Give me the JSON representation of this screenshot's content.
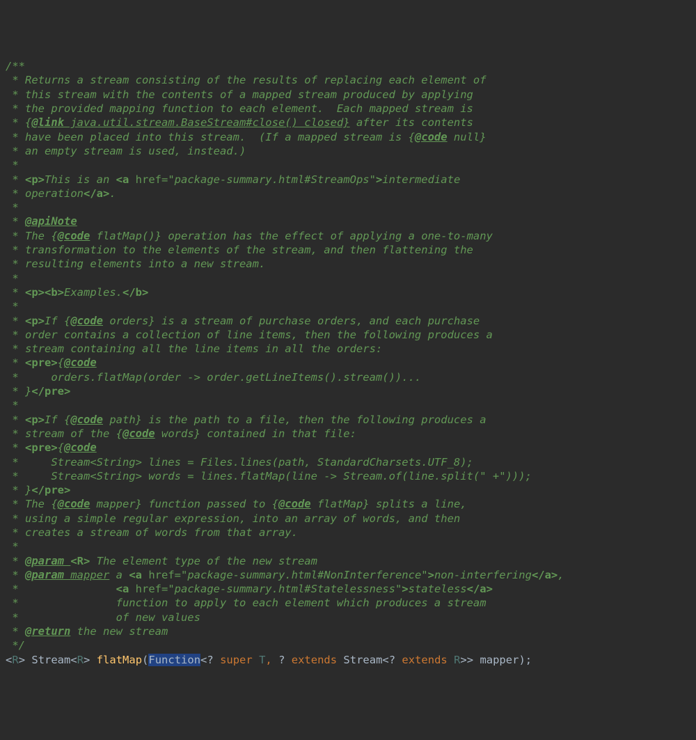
{
  "doc": {
    "l1": "/**",
    "l2a": " * ",
    "l2b": "Returns a stream consisting of the results of replacing each element of",
    "l3a": " * ",
    "l3b": "this stream with the contents of a mapped stream produced by applying",
    "l4a": " * ",
    "l4b": "the provided mapping function to each element.  Each mapped stream is",
    "l5a": " * ",
    "l5b": "{",
    "l5c": "@link",
    "l5d": " java.util.stream.BaseStream#close() closed}",
    "l5e": " after its contents",
    "l6a": " * ",
    "l6b": "have been placed into this stream.  (If a mapped stream is {",
    "l6c": "@code",
    "l6d": " null}",
    "l7a": " * ",
    "l7b": "an empty stream is used, instead.)",
    "l8": " *",
    "l9a": " * ",
    "l9b": "<p>",
    "l9c": "This is an ",
    "l9d": "<a ",
    "l9e": "href=",
    "l9f": "\"package-summary.html#StreamOps\"",
    "l9g": ">",
    "l9h": "intermediate",
    "l10a": " * ",
    "l10b": "operation",
    "l10c": "</a>",
    "l10d": ".",
    "l11": " *",
    "l12a": " * ",
    "l12b": "@apiNote",
    "l13a": " * ",
    "l13b": "The {",
    "l13c": "@code",
    "l13d": " flatMap()} operation has the effect of applying a one-to-many",
    "l14a": " * ",
    "l14b": "transformation to the elements of the stream, and then flattening the",
    "l15a": " * ",
    "l15b": "resulting elements into a new stream.",
    "l16": " *",
    "l17a": " * ",
    "l17b": "<p><b>",
    "l17c": "Examples.",
    "l17d": "</b>",
    "l18": " *",
    "l19a": " * ",
    "l19b": "<p>",
    "l19c": "If {",
    "l19d": "@code",
    "l19e": " orders} is a stream of purchase orders, and each purchase",
    "l20a": " * ",
    "l20b": "order contains a collection of line items, then the following produces a",
    "l21a": " * ",
    "l21b": "stream containing all the line items in all the orders:",
    "l22a": " * ",
    "l22b": "<pre>",
    "l22c": "{",
    "l22d": "@code",
    "l23a": " * ",
    "l23b": "    orders.flatMap(order -> order.getLineItems().stream())...",
    "l24a": " * ",
    "l24b": "}",
    "l24c": "</pre>",
    "l25": " *",
    "l26a": " * ",
    "l26b": "<p>",
    "l26c": "If {",
    "l26d": "@code",
    "l26e": " path} is the path to a file, then the following produces a",
    "l27a": " * ",
    "l27b": "stream of the {",
    "l27c": "@code",
    "l27d": " words} contained in that file:",
    "l28a": " * ",
    "l28b": "<pre>",
    "l28c": "{",
    "l28d": "@code",
    "l29a": " * ",
    "l29b": "    Stream<String> lines = Files.lines(path, StandardCharsets.UTF_8);",
    "l30a": " * ",
    "l30b": "    Stream<String> words = lines.flatMap(line -> Stream.of(line.split(\" +\")));",
    "l31a": " * ",
    "l31b": "}",
    "l31c": "</pre>",
    "l32a": " * ",
    "l32b": "The {",
    "l32c": "@code",
    "l32d": " mapper} function passed to {",
    "l32e": "@code",
    "l32f": " flatMap} splits a line,",
    "l33a": " * ",
    "l33b": "using a simple regular expression, into an array of words, and then",
    "l34a": " * ",
    "l34b": "creates a stream of words from that array.",
    "l35": " *",
    "l36a": " * ",
    "l36b": "@param ",
    "l36c": "<R>",
    "l36d": " The element type of the new stream",
    "l37a": " * ",
    "l37b": "@param ",
    "l37c": "mapper",
    "l37d": " a ",
    "l37e": "<a ",
    "l37f": "href=",
    "l37g": "\"package-summary.html#NonInterference\"",
    "l37h": ">",
    "l37i": "non-interfering",
    "l37j": "</a>",
    "l37k": ",",
    "l38a": " * ",
    "l38b": "              ",
    "l38c": "<a ",
    "l38d": "href=",
    "l38e": "\"package-summary.html#Statelessness\"",
    "l38f": ">",
    "l38g": "stateless",
    "l38h": "</a>",
    "l39a": " * ",
    "l39b": "              function to apply to each element which produces a stream",
    "l40a": " * ",
    "l40b": "              of new values",
    "l41a": " * ",
    "l41b": "@return",
    "l41c": " the new stream",
    "l42": " */"
  },
  "sig": {
    "lt1": "<",
    "R1": "R",
    "gt1": "> ",
    "Stream": "Stream",
    "lt2": "<",
    "R2": "R",
    "gt2": "> ",
    "flatMap": "flatMap",
    "op": "(",
    "Function": "Function",
    "lt3": "<",
    "wild1": "? ",
    "super": "super ",
    "T": "T",
    "comma": ", ",
    "wild2": "? ",
    "extends1": "extends ",
    "Stream2": "Stream",
    "lt4": "<",
    "wild3": "? ",
    "extends2": "extends ",
    "R3": "R",
    "gt3": ">>",
    "sp": " ",
    "mapper": "mapper",
    "cp": ");"
  }
}
